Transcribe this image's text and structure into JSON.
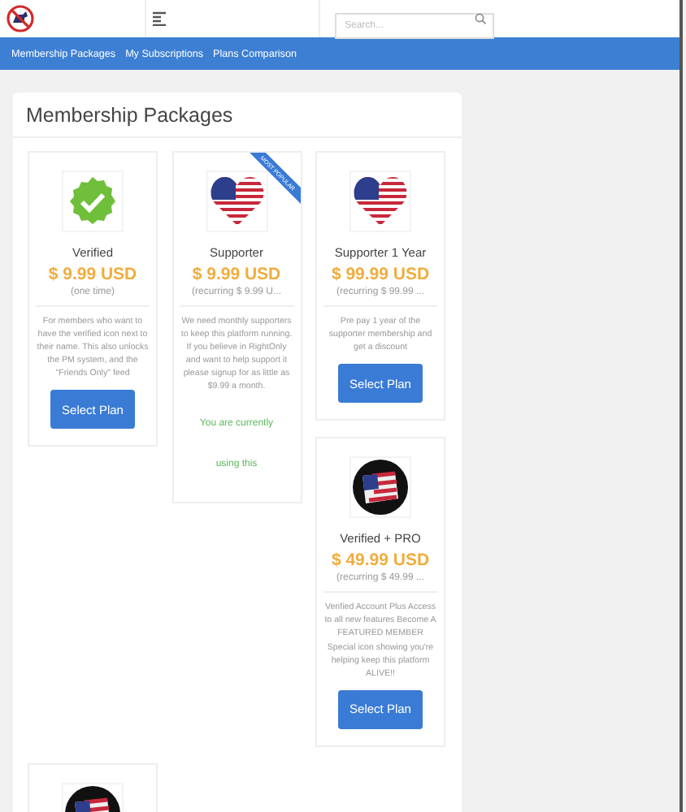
{
  "header": {
    "search": {
      "placeholder": "Search..."
    }
  },
  "nav": [
    "Membership Packages",
    "My Subscriptions",
    "Plans Comparison"
  ],
  "title": "Membership Packages",
  "packages": [
    {
      "kind": "check",
      "name": "Verified",
      "price": "$ 9.99 USD",
      "period": "(one time)",
      "description": "For members who want to have the verified icon next to their name. This also unlocks the PM system, and the \"Friends Only\" feed",
      "action": {
        "kind": "button",
        "label": "Select Plan"
      }
    },
    {
      "kind": "heart-flag",
      "ribbon": "MOST POPULAR",
      "name": "Supporter",
      "price": "$ 9.99 USD",
      "period": "(recurring $ 9.99 U...",
      "description": "We need monthly supporters to keep this platform running. If you believe in RightOnly and want to help support it please signup for as little as $9.99 a month.",
      "action": {
        "kind": "current",
        "label": "You are currently using this"
      }
    },
    {
      "kind": "heart-flag",
      "name": "Supporter 1 Year",
      "price": "$ 99.99 USD",
      "period": "(recurring $ 99.99 ...",
      "description": "Pre pay 1 year of the supporter membership and get a discount",
      "action": {
        "kind": "button",
        "label": "Select Plan"
      }
    },
    {
      "kind": "flag-circle",
      "name": "Verified + PRO",
      "price": "$ 49.99 USD",
      "period": "(recurring $ 49.99 ...",
      "description": "Verified Account Plus Access to all new features Become A FEATURED MEMBER Special icon showing you're helping keep this platform ALIVE!!",
      "action": {
        "kind": "button",
        "label": "Select Plan"
      }
    },
    {
      "kind": "flag-circle"
    }
  ]
}
